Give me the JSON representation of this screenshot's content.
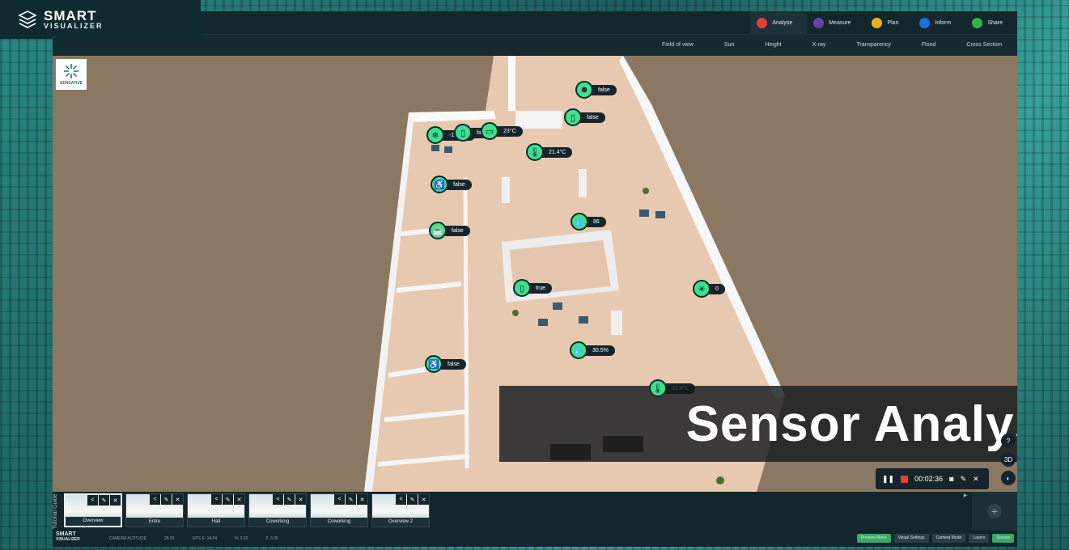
{
  "app": {
    "logo_line1": "SMART",
    "logo_line2": "VISUALIZER",
    "brand": "SENSATIVE"
  },
  "modes": [
    {
      "label": "Analyse",
      "color": "#e0413a"
    },
    {
      "label": "Measure",
      "color": "#6a3fa5"
    },
    {
      "label": "Plan",
      "color": "#e8b01c"
    },
    {
      "label": "Inform",
      "color": "#1f6fe0"
    },
    {
      "label": "Share",
      "color": "#2fb54a"
    }
  ],
  "tools": [
    "Field of view",
    "Sun",
    "Height",
    "X-ray",
    "Transparency",
    "Flood",
    "Cross Section"
  ],
  "sensors": [
    {
      "icon": "person-icon",
      "value": "false"
    },
    {
      "icon": "door-icon",
      "value": "false"
    },
    {
      "icon": "snowflake-icon",
      "value": "-19.3°C"
    },
    {
      "icon": "door-icon",
      "value": "fal"
    },
    {
      "icon": "fridge-icon",
      "value": "23°C"
    },
    {
      "icon": "thermometer-icon",
      "value": "21.4°C"
    },
    {
      "icon": "chair-icon",
      "value": "false"
    },
    {
      "icon": "water-drop-icon",
      "value": "86"
    },
    {
      "icon": "coffee-icon",
      "value": "false"
    },
    {
      "icon": "door-icon",
      "value": "true"
    },
    {
      "icon": "light-icon",
      "value": "0"
    },
    {
      "icon": "humidity-icon",
      "value": "30.5%"
    },
    {
      "icon": "chair-icon",
      "value": "false"
    },
    {
      "icon": "thermometer-icon",
      "value": "22.4°C"
    }
  ],
  "overlay_title": "Sensor Analys",
  "recorder": {
    "time": "00:02:36"
  },
  "side_buttons": [
    "?",
    "3D",
    "◐"
  ],
  "tutorial_guide": "Tutorial Guide",
  "scenes": [
    "Overview",
    "Entre",
    "Hall",
    "Coworking",
    "Coworking",
    "Overview 2"
  ],
  "status": {
    "camera_altitude": "CAMERA ALTITUDE",
    "altitude_value": "28.93",
    "gps": "GPS  E: 14.04",
    "n": "N: 3.16",
    "z": "Z: 3.00"
  },
  "status_buttons": [
    "Preview Mode",
    "Visual Settings",
    "Camera Mode",
    "Layers",
    "Scenes"
  ]
}
